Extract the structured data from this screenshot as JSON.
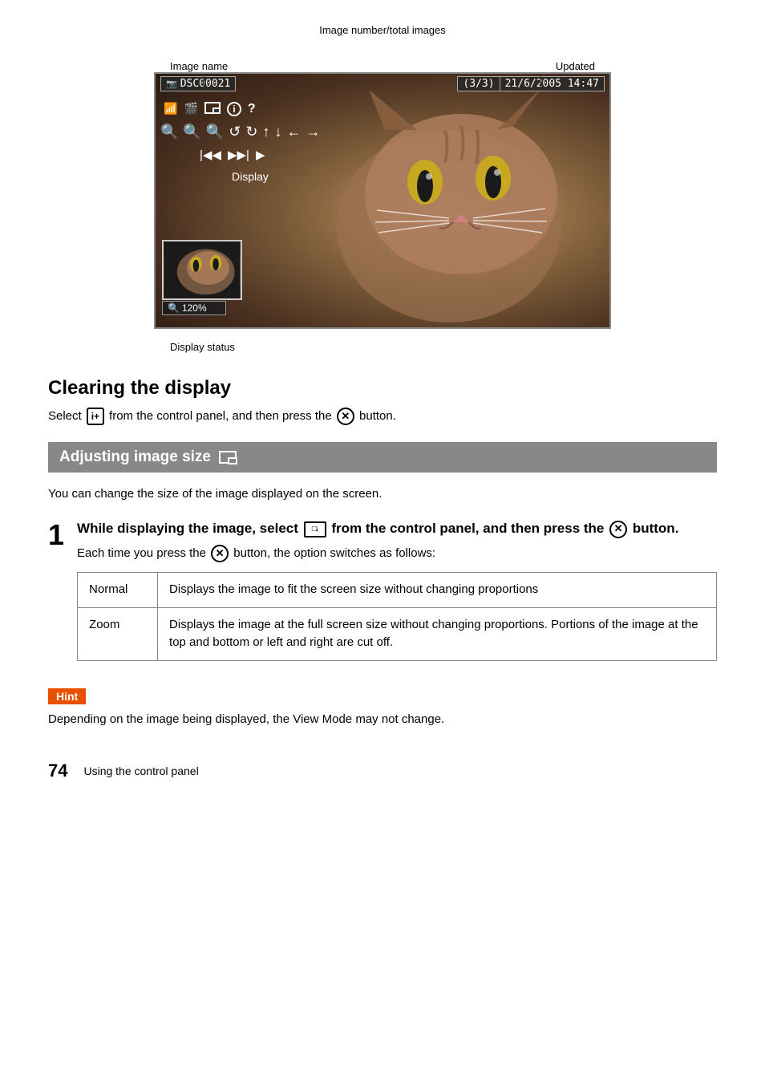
{
  "camera_display": {
    "image_name_label": "Image name",
    "image_number_label": "Image number/total images",
    "updated_label": "Updated",
    "filename": "DSC00021",
    "frame_info": "(3/3)",
    "date_time": "21/6/2005  14:47",
    "display_label": "Display",
    "zoom_value": "120%",
    "display_status_label": "Display status",
    "controls_row1": [
      "🌐",
      "📷",
      "▣",
      "ℹ",
      "?"
    ],
    "controls_row2": [
      "🔍",
      "🔍",
      "🔍",
      "↩",
      "↩",
      "↑",
      "↓",
      "←",
      "→"
    ],
    "controls_row3": [
      "|◀◀",
      "▶▶|",
      "▶"
    ]
  },
  "clearing": {
    "title": "Clearing the display",
    "body_before_icon1": "Select ",
    "icon1_label": "i+",
    "body_between": " from the control panel, and then press the ",
    "icon2_label": "✕",
    "body_after": " button."
  },
  "adjusting": {
    "header_title": "Adjusting image size",
    "intro": "You can change the size of the image displayed on the screen.",
    "step1": {
      "number": "1",
      "title_before": "While displaying the image, select ",
      "title_icon": "□ᵢᵢ",
      "title_after": " from the control panel, and then press the ",
      "title_icon2": "✕",
      "title_end": " button.",
      "body_before": "Each time you press the ",
      "body_icon": "✕",
      "body_after": " button, the option switches as follows:"
    },
    "table": {
      "rows": [
        {
          "option": "Normal",
          "description": "Displays the image to fit the screen size without changing proportions"
        },
        {
          "option": "Zoom",
          "description": "Displays the image at the full screen size without changing proportions. Portions of the image at the top and bottom or left and right are cut off."
        }
      ]
    },
    "hint": {
      "label": "Hint",
      "text": "Depending on the image being displayed, the View Mode may not change."
    }
  },
  "footer": {
    "page_number": "74",
    "text": "Using the control panel"
  }
}
